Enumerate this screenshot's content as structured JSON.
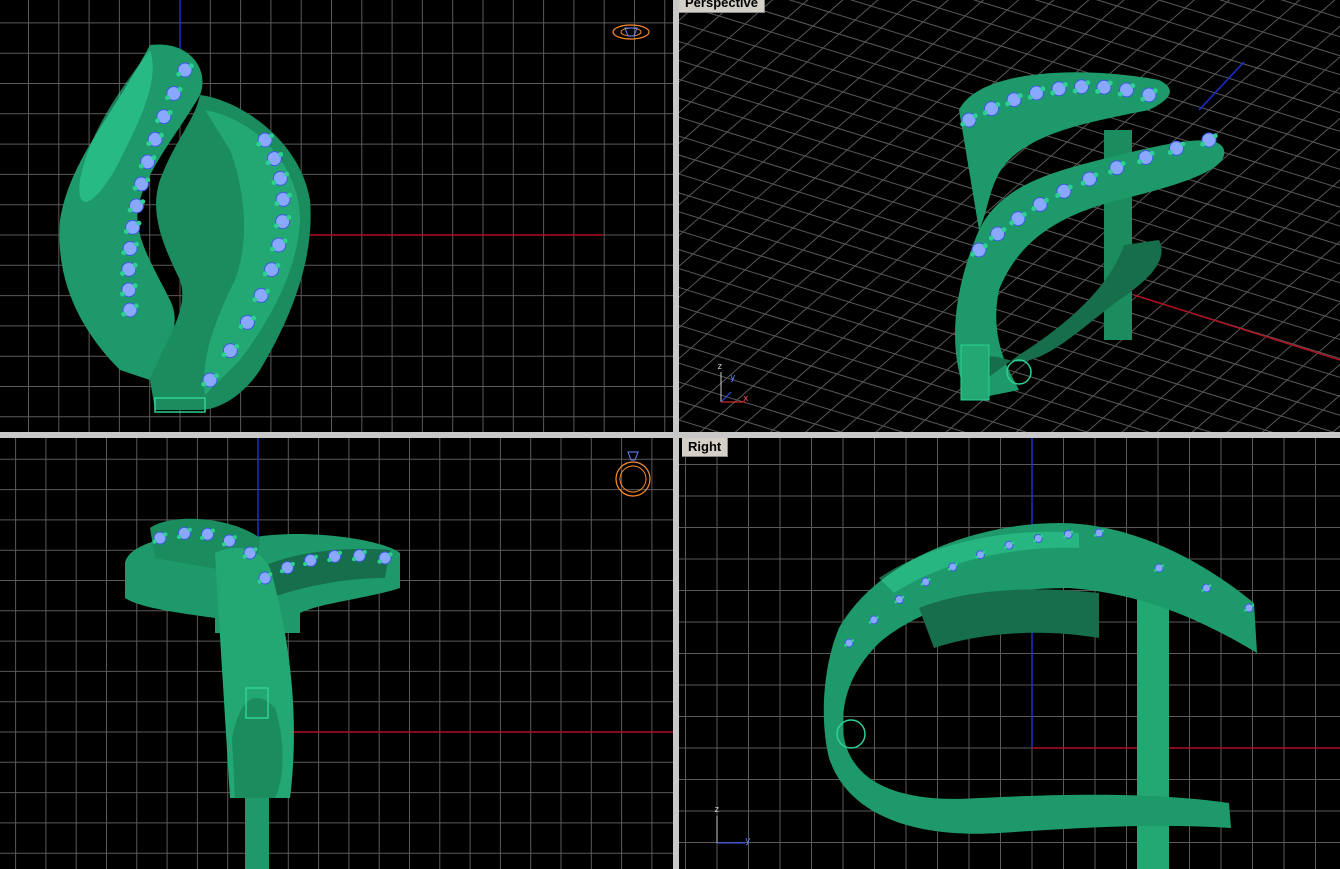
{
  "viewports": {
    "top": {
      "title": ""
    },
    "perspective": {
      "title": "Perspective"
    },
    "front": {
      "title": ""
    },
    "right": {
      "title": "Right"
    }
  },
  "axis_labels": {
    "perspective": {
      "z": "z",
      "y": "y",
      "x": "x"
    },
    "right": {
      "z": "z",
      "y": "y"
    }
  },
  "colors": {
    "background": "#000000",
    "grid": "#5a5a5a",
    "x_axis": "#8b0000",
    "y_axis": "#00008b",
    "model_green": "#1f9d6c",
    "gem_blue": "#8aa8ff",
    "separator": "#c8c8c8",
    "title_bg": "#d4d0c8"
  }
}
